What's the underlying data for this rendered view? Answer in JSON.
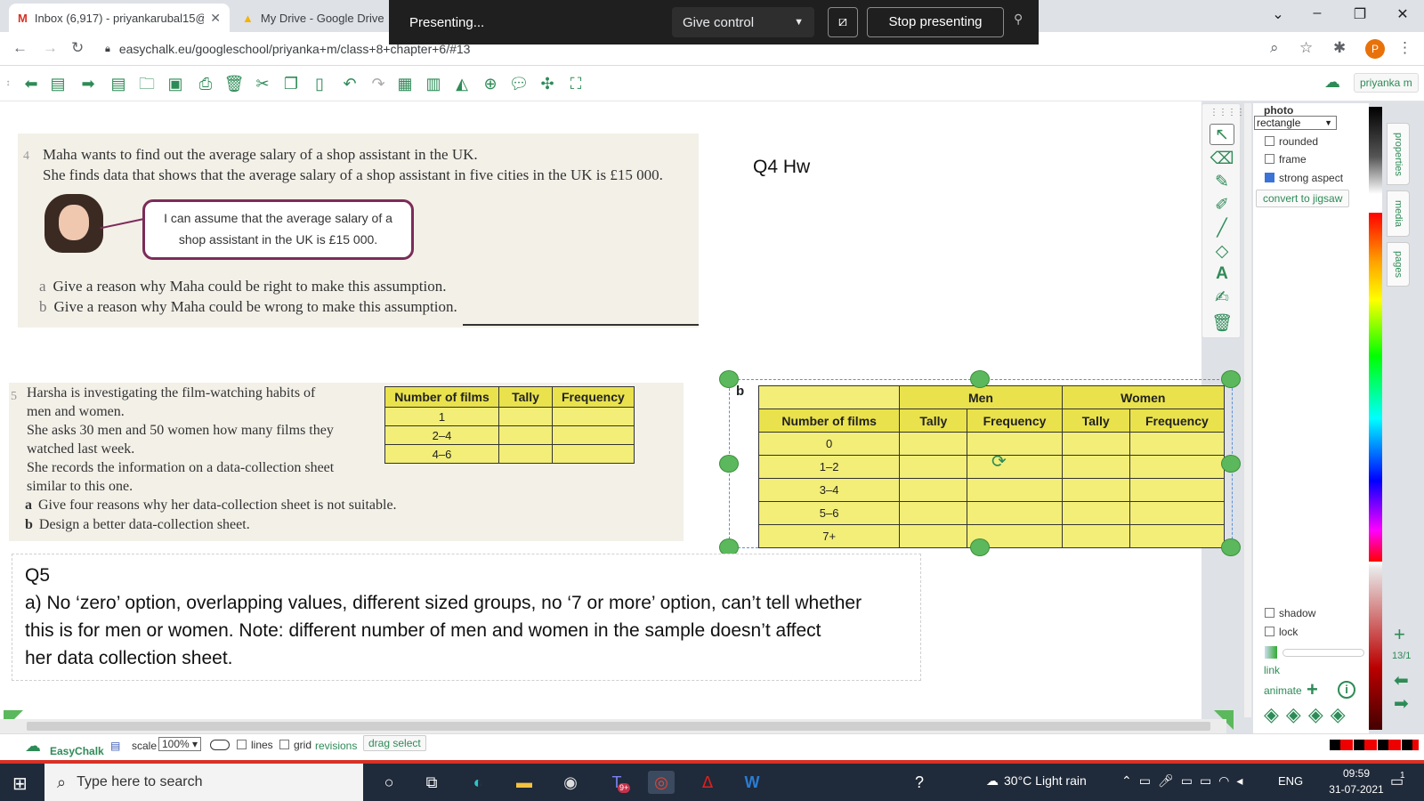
{
  "browser": {
    "tabs": [
      {
        "title": "Inbox (6,917) - priyankarubal15@",
        "icon": "gmail-icon"
      },
      {
        "title": "My Drive - Google Drive",
        "icon": "drive-icon"
      }
    ],
    "url": "easychalk.eu/googleschool/priyanka+m/class+8+chapter+6/#13",
    "avatar_letter": "P"
  },
  "presenting": {
    "status": "Presenting...",
    "give_control": "Give control",
    "stop": "Stop presenting"
  },
  "app": {
    "user": "priyanka m",
    "brand": "EasyChalk",
    "scale_label": "scale",
    "scale_value": "100%",
    "lines": "lines",
    "grid": "grid",
    "revisions": "revisions",
    "drag_select": "drag select",
    "page_indicator": "13/1"
  },
  "slide": {
    "q4_heading": "Q4  Hw",
    "book1": {
      "number": "4",
      "line1": "Maha wants to find out the average salary of a shop assistant in the UK.",
      "line2": "She finds data that shows that the average salary of a shop assistant in five cities in the UK is £15 000.",
      "bubble_line1": "I can assume that the average salary of a",
      "bubble_line2": "shop assistant in the UK is £15 000.",
      "qa_letter": "a",
      "qa": "Give a reason why Maha could be right to make this assumption.",
      "qb_letter": "b",
      "qb": "Give a reason why Maha could be wrong to make this assumption."
    },
    "book2": {
      "number": "5",
      "lines": [
        "Harsha is investigating the film-watching habits of",
        "men and women.",
        "She asks 30 men and 50 women how many films they",
        "watched last week.",
        "She records the information on a data-collection sheet",
        "similar to this one."
      ],
      "qa_letter": "a",
      "qa": "Give four reasons why her data-collection sheet is not suitable.",
      "qb_letter": "b",
      "qb": "Design a better data-collection sheet.",
      "table": {
        "headers": [
          "Number of films",
          "Tally",
          "Frequency"
        ],
        "rows": [
          "1",
          "2–4",
          "4–6"
        ]
      }
    },
    "table_b": {
      "label": "b",
      "group_men": "Men",
      "group_women": "Women",
      "headers": [
        "Number of films",
        "Tally",
        "Frequency",
        "Tally",
        "Frequency"
      ],
      "rows": [
        "0",
        "1–2",
        "3–4",
        "5–6",
        "7+"
      ]
    },
    "q5": {
      "title": "Q5",
      "lines": [
        "a) No ‘zero’ option, overlapping values, different sized groups, no ‘7 or more’ option, can’t tell whether",
        "this is for men or women. Note: different number of men and women in the sample doesn’t affect",
        "her data collection sheet."
      ]
    }
  },
  "properties": {
    "heading": "photo",
    "shape": "rectangle",
    "rounded": "rounded",
    "frame": "frame",
    "strong_aspect": "strong aspect",
    "convert": "convert to jigsaw",
    "shadow": "shadow",
    "lock": "lock",
    "link": "link",
    "animate": "animate",
    "tabs": [
      "properties",
      "media",
      "pages"
    ]
  },
  "taskbar": {
    "search_placeholder": "Type here to search",
    "weather": "30°C  Light rain",
    "lang": "ENG",
    "time": "09:59",
    "date": "31-07-2021",
    "teams_badge": "9+",
    "notif_count": "1"
  }
}
